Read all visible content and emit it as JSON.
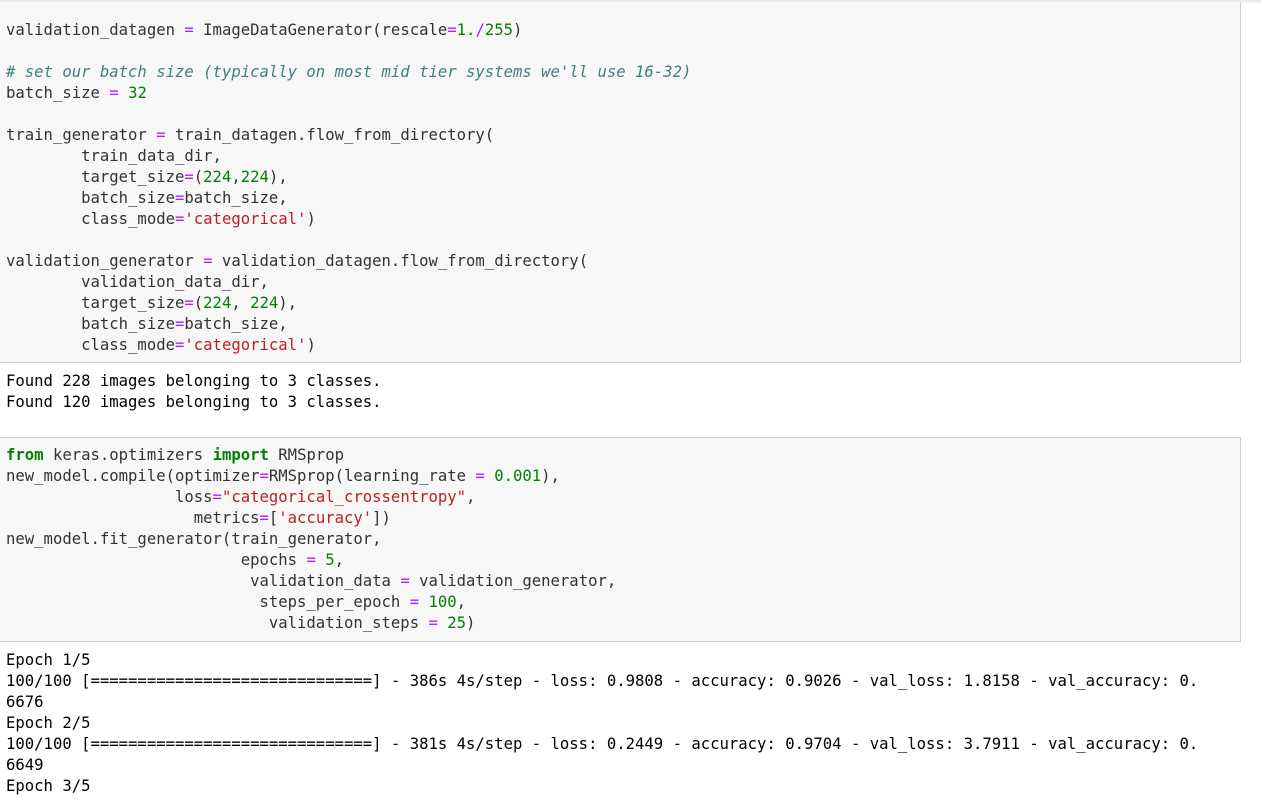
{
  "cell1": {
    "lines": [
      [
        [
          "validation_datagen ",
          ""
        ],
        [
          "=",
          "o"
        ],
        [
          " ImageDataGenerator(rescale",
          ""
        ],
        [
          "=",
          "o"
        ],
        [
          "1.",
          "n"
        ],
        [
          "/",
          "o"
        ],
        [
          "255",
          "n"
        ],
        [
          ")",
          ""
        ]
      ],
      [],
      [
        [
          "# set our batch size (typically on most mid tier systems we'll use 16-32)",
          "c"
        ]
      ],
      [
        [
          "batch_size ",
          ""
        ],
        [
          "=",
          "o"
        ],
        [
          " ",
          ""
        ],
        [
          "32",
          "n"
        ]
      ],
      [],
      [
        [
          "train_generator ",
          ""
        ],
        [
          "=",
          "o"
        ],
        [
          " train_datagen.flow_from_directory(",
          ""
        ]
      ],
      [
        [
          "        train_data_dir,",
          ""
        ]
      ],
      [
        [
          "        target_size",
          ""
        ],
        [
          "=",
          "o"
        ],
        [
          "(",
          ""
        ],
        [
          "224",
          "n"
        ],
        [
          ",",
          ""
        ],
        [
          "224",
          "n"
        ],
        [
          "),",
          ""
        ]
      ],
      [
        [
          "        batch_size",
          ""
        ],
        [
          "=",
          "o"
        ],
        [
          "batch_size,",
          ""
        ]
      ],
      [
        [
          "        class_mode",
          ""
        ],
        [
          "=",
          "o"
        ],
        [
          "'categorical'",
          "s"
        ],
        [
          ")",
          ""
        ]
      ],
      [],
      [
        [
          "validation_generator ",
          ""
        ],
        [
          "=",
          "o"
        ],
        [
          " validation_datagen.flow_from_directory(",
          ""
        ]
      ],
      [
        [
          "        validation_data_dir,",
          ""
        ]
      ],
      [
        [
          "        target_size",
          ""
        ],
        [
          "=",
          "o"
        ],
        [
          "(",
          ""
        ],
        [
          "224",
          "n"
        ],
        [
          ", ",
          ""
        ],
        [
          "224",
          "n"
        ],
        [
          "),",
          ""
        ]
      ],
      [
        [
          "        batch_size",
          ""
        ],
        [
          "=",
          "o"
        ],
        [
          "batch_size,",
          ""
        ]
      ],
      [
        [
          "        class_mode",
          ""
        ],
        [
          "=",
          "o"
        ],
        [
          "'categorical'",
          "s"
        ],
        [
          ")",
          ""
        ]
      ]
    ]
  },
  "output1": {
    "lines": [
      "Found 228 images belonging to 3 classes.",
      "Found 120 images belonging to 3 classes."
    ]
  },
  "cell2": {
    "lines": [
      [
        [
          "from",
          "k"
        ],
        [
          " keras.optimizers ",
          ""
        ],
        [
          "import",
          "k"
        ],
        [
          " RMSprop",
          ""
        ]
      ],
      [
        [
          "new_model.compile(optimizer",
          ""
        ],
        [
          "=",
          "o"
        ],
        [
          "RMSprop(learning_rate ",
          ""
        ],
        [
          "=",
          "o"
        ],
        [
          " ",
          ""
        ],
        [
          "0.001",
          "n"
        ],
        [
          "),",
          ""
        ]
      ],
      [
        [
          "                  loss",
          ""
        ],
        [
          "=",
          "o"
        ],
        [
          "\"categorical_crossentropy\"",
          "s"
        ],
        [
          ",",
          ""
        ]
      ],
      [
        [
          "                    metrics",
          ""
        ],
        [
          "=",
          "o"
        ],
        [
          "[",
          ""
        ],
        [
          "'accuracy'",
          "s"
        ],
        [
          "])",
          ""
        ]
      ],
      [
        [
          "new_model.fit_generator(train_generator,",
          ""
        ]
      ],
      [
        [
          "                         epochs ",
          ""
        ],
        [
          "=",
          "o"
        ],
        [
          " ",
          ""
        ],
        [
          "5",
          "n"
        ],
        [
          ",",
          ""
        ]
      ],
      [
        [
          "                          validation_data ",
          ""
        ],
        [
          "=",
          "o"
        ],
        [
          " validation_generator,",
          ""
        ]
      ],
      [
        [
          "                           steps_per_epoch ",
          ""
        ],
        [
          "=",
          "o"
        ],
        [
          " ",
          ""
        ],
        [
          "100",
          "n"
        ],
        [
          ",",
          ""
        ]
      ],
      [
        [
          "                            validation_steps ",
          ""
        ],
        [
          "=",
          "o"
        ],
        [
          " ",
          ""
        ],
        [
          "25",
          "n"
        ],
        [
          ")",
          ""
        ]
      ]
    ]
  },
  "output2": {
    "lines": [
      "Epoch 1/5",
      "100/100 [==============================] - 386s 4s/step - loss: 0.9808 - accuracy: 0.9026 - val_loss: 1.8158 - val_accuracy: 0.",
      "6676",
      "Epoch 2/5",
      "100/100 [==============================] - 381s 4s/step - loss: 0.2449 - accuracy: 0.9704 - val_loss: 3.7911 - val_accuracy: 0.",
      "6649",
      "Epoch 3/5"
    ]
  }
}
